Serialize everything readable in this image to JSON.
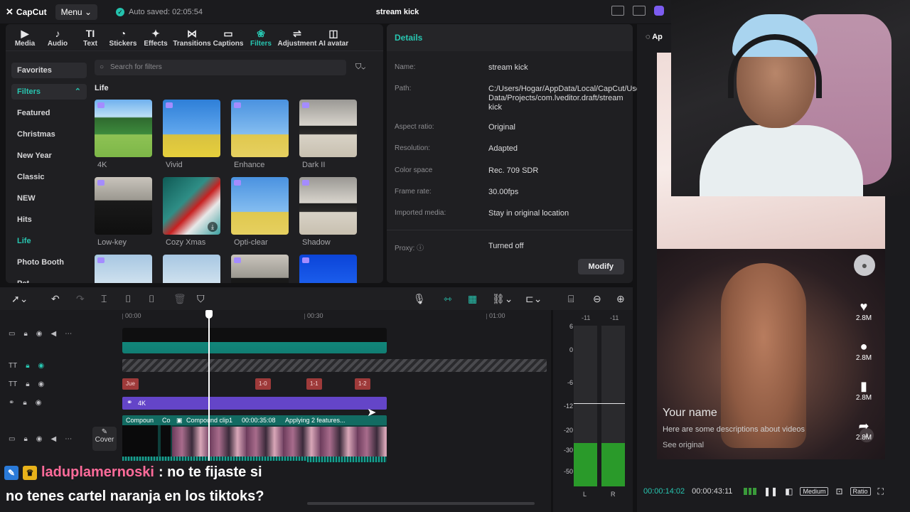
{
  "app": {
    "name": "CapCut",
    "menu_label": "Menu",
    "autosave": "Auto saved: 02:05:54",
    "project_title": "stream kick"
  },
  "media_tabs": [
    {
      "label": "Media",
      "icon": "media-icon",
      "glyph": "▶"
    },
    {
      "label": "Audio",
      "icon": "audio-icon",
      "glyph": "♪"
    },
    {
      "label": "Text",
      "icon": "text-icon",
      "glyph": "TI"
    },
    {
      "label": "Stickers",
      "icon": "stickers-icon",
      "glyph": "◔"
    },
    {
      "label": "Effects",
      "icon": "effects-icon",
      "glyph": "✦"
    },
    {
      "label": "Transitions",
      "icon": "transitions-icon",
      "glyph": "⋈"
    },
    {
      "label": "Captions",
      "icon": "captions-icon",
      "glyph": "▭"
    },
    {
      "label": "Filters",
      "icon": "filters-icon",
      "glyph": "❀"
    },
    {
      "label": "Adjustment",
      "icon": "adjustment-icon",
      "glyph": "⇌"
    },
    {
      "label": "AI avatar",
      "icon": "ai-avatar-icon",
      "glyph": "◫"
    }
  ],
  "sidebar": {
    "favorites": "Favorites",
    "filters": "Filters",
    "items": [
      "Featured",
      "Christmas",
      "New Year",
      "Classic",
      "NEW",
      "Hits",
      "Life",
      "Photo Booth",
      "Pet"
    ]
  },
  "search_placeholder": "Search for filters",
  "section_label": "Life",
  "filters": [
    {
      "label": "4K"
    },
    {
      "label": "Vivid"
    },
    {
      "label": "Enhance"
    },
    {
      "label": "Dark II"
    },
    {
      "label": "Low-key"
    },
    {
      "label": "Cozy Xmas"
    },
    {
      "label": "Opti-clear"
    },
    {
      "label": "Shadow"
    }
  ],
  "details": {
    "heading": "Details",
    "rows": [
      {
        "label": "Name:",
        "value": "stream kick"
      },
      {
        "label": "Path:",
        "value": "C:/Users/Hogar/AppData/Local/CapCut/User Data/Projects/com.lveditor.draft/stream kick"
      },
      {
        "label": "Aspect ratio:",
        "value": "Original"
      },
      {
        "label": "Resolution:",
        "value": "Adapted"
      },
      {
        "label": "Color space",
        "value": "Rec. 709 SDR"
      },
      {
        "label": "Frame rate:",
        "value": "30.00fps"
      },
      {
        "label": "Imported media:",
        "value": "Stay in original location"
      },
      {
        "label": "Proxy:",
        "value": "Turned off"
      }
    ],
    "modify": "Modify"
  },
  "player": {
    "tab_label": "Ap",
    "current_time": "00:00:14:02",
    "total_time": "00:00:43:11",
    "quality": "Medium",
    "ratio": "Ratio",
    "tiktok": {
      "name": "Your name",
      "description": "Here are some descriptions about videos",
      "see_original": "See original",
      "likes": "2.8M",
      "comments": "2.8M",
      "saves": "2.8M",
      "shares": "2.8M"
    }
  },
  "timeline": {
    "ruler": [
      "00:00",
      "00:30",
      "01:00"
    ],
    "text_clips": [
      "Jue",
      "1-0",
      "1-1",
      "1-2"
    ],
    "filter_clip": "4K",
    "compound_labels": [
      "Compoun",
      "Co",
      "Compound clip1",
      "00:00:35:08",
      "Applying 2 features..."
    ],
    "cover": "Cover"
  },
  "meters": {
    "peaks": [
      "-11",
      "-11"
    ],
    "scale": [
      "6",
      "0",
      "-6",
      "-12",
      "-20",
      "-30",
      "-50"
    ],
    "channels": [
      "L",
      "R"
    ],
    "level_fraction": 0.27
  },
  "chat": {
    "username": "laduplamernoski",
    "line1": ": no te fijaste si",
    "line2": "no tenes cartel naranja en los tiktoks?"
  },
  "colors": {
    "accent": "#28c6b1",
    "filter_clip": "#6445c8",
    "text_clip": "#9e3a3a",
    "chat_user": "#ff6b9a"
  }
}
